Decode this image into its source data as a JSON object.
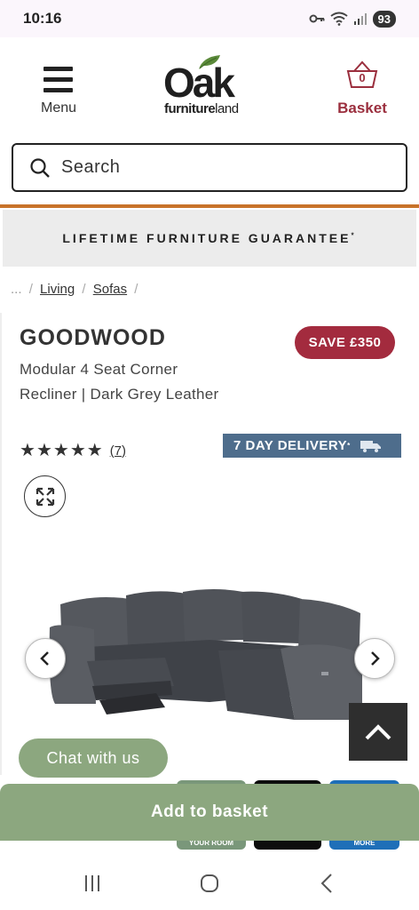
{
  "status_bar": {
    "time": "10:16",
    "battery": "93"
  },
  "header": {
    "menu_label": "Menu",
    "logo_main": "Oak",
    "logo_sub_bold": "furniture",
    "logo_sub_light": "land",
    "basket_count": "0",
    "basket_label": "Basket"
  },
  "search": {
    "placeholder": "Search"
  },
  "banner": {
    "text": "LIFETIME FURNITURE GUARANTEE",
    "mark": "*"
  },
  "breadcrumb": {
    "ellipsis": "...",
    "items": [
      "Living",
      "Sofas"
    ],
    "separator": "/"
  },
  "product": {
    "name": "GOODWOOD",
    "save_badge": "SAVE £350",
    "subtitle": "Modular 4 Seat Corner Recliner | Dark Grey Leather",
    "rating": 5,
    "review_count": "(7)",
    "delivery": "7 DAY DELIVERY",
    "delivery_mark": "*"
  },
  "thumbnails": {
    "room_label": "YOUR ROOM",
    "more_label": "MORE"
  },
  "chat": {
    "label": "Chat with us"
  },
  "cta": {
    "add_to_basket": "Add to basket"
  },
  "colors": {
    "brand_red": "#a32b3e",
    "cta_green": "#8ca77f",
    "delivery_blue": "#4e6d8c",
    "divider_orange": "#c8732a"
  },
  "icons": [
    "menu-icon",
    "leaf-icon",
    "basket-icon",
    "search-icon",
    "expand-icon",
    "chevron-left-icon",
    "chevron-right-icon",
    "chevron-up-icon",
    "truck-icon",
    "recents-icon",
    "home-icon",
    "back-icon"
  ]
}
